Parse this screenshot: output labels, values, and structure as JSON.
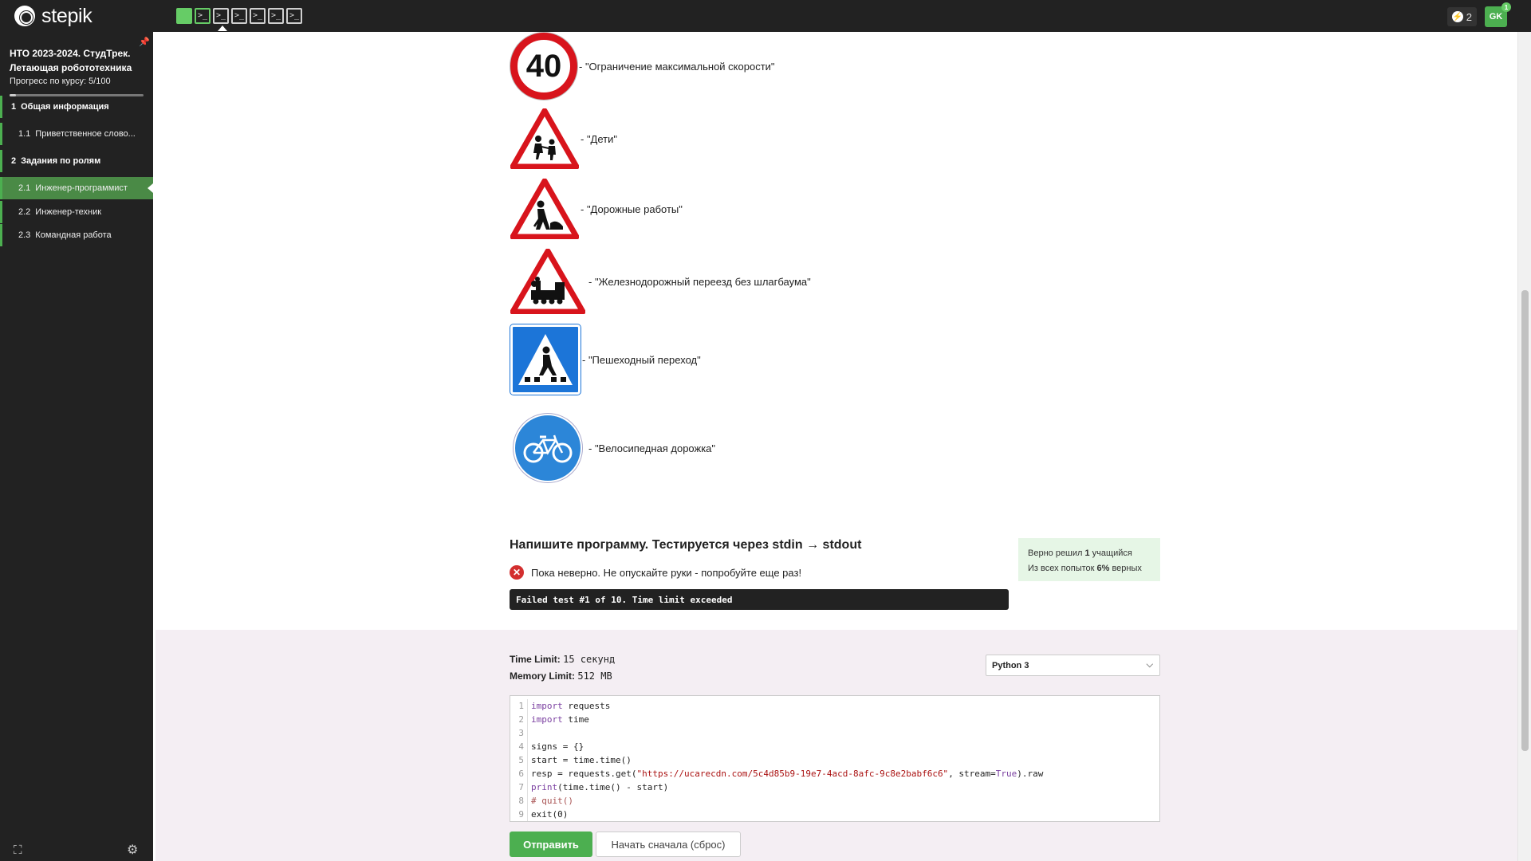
{
  "topbar": {
    "logo_text": "stepik",
    "steps": [
      "",
      ">_",
      ">_",
      ">_",
      ">_",
      ">_",
      ">_"
    ],
    "notifications_count": "2",
    "avatar_initials": "GK",
    "avatar_badge": "1"
  },
  "sidebar": {
    "course_title": "НТО 2023-2024. СтудТрек. Летающая робототехника",
    "progress_text": "Прогресс по курсу:  5/100",
    "progress_value": 0.05,
    "items": [
      {
        "num": "1",
        "label": "Общая информация"
      },
      {
        "num": "1.1",
        "label": "Приветственное слово..."
      },
      {
        "num": "2",
        "label": "Задания по ролям"
      },
      {
        "num": "2.1",
        "label": "Инженер-программист"
      },
      {
        "num": "2.2",
        "label": "Инженер-техник"
      },
      {
        "num": "2.3",
        "label": "Командная работа"
      }
    ]
  },
  "signs": [
    {
      "icon": "speed-limit-40-sign",
      "symbol": "40",
      "label": "- \"Ограничение максимальной скорости\""
    },
    {
      "icon": "children-sign",
      "label": "- \"Дети\""
    },
    {
      "icon": "road-works-sign",
      "label": "- \"Дорожные работы\""
    },
    {
      "icon": "railway-crossing-sign",
      "label": "- \"Железнодорожный переезд без шлагбаума\""
    },
    {
      "icon": "pedestrian-crossing-sign",
      "label": "- \"Пешеходный переход\""
    },
    {
      "icon": "bicycle-path-sign",
      "label": "- \"Велосипедная дорожка\""
    }
  ],
  "task": {
    "title": "Напишите программу. Тестируется через stdin → stdout",
    "status": "Пока неверно. Не опускайте руки - попробуйте еще раз!",
    "failure": "Failed test #1 of 10. Time limit exceeded",
    "stats_line1_prefix": "Верно решил ",
    "stats_line1_count": "1",
    "stats_line1_suffix": " учащийся",
    "stats_line2_prefix": "Из всех попыток ",
    "stats_line2_value": "6%",
    "stats_line2_suffix": " верных"
  },
  "limits": {
    "time_label": "Time Limit:",
    "time_value": "15 секунд",
    "memory_label": "Memory Limit:",
    "memory_value": "512 MB"
  },
  "language": "Python 3",
  "code_lines": [
    "import requests",
    "import time",
    "",
    "signs = {}",
    "start = time.time()",
    "resp = requests.get(\"https://ucarecdn.com/5c4d85b9-19e7-4acd-8afc-9c8e2babf6c6\", stream=True).raw",
    "print(time.time() - start)",
    "# quit()",
    "exit(0)"
  ],
  "buttons": {
    "submit": "Отправить",
    "reset": "Начать сначала (сброс)"
  },
  "colors": {
    "accent": "#4caf50",
    "sidebar_bg": "#222222",
    "error": "#d32f2f"
  }
}
